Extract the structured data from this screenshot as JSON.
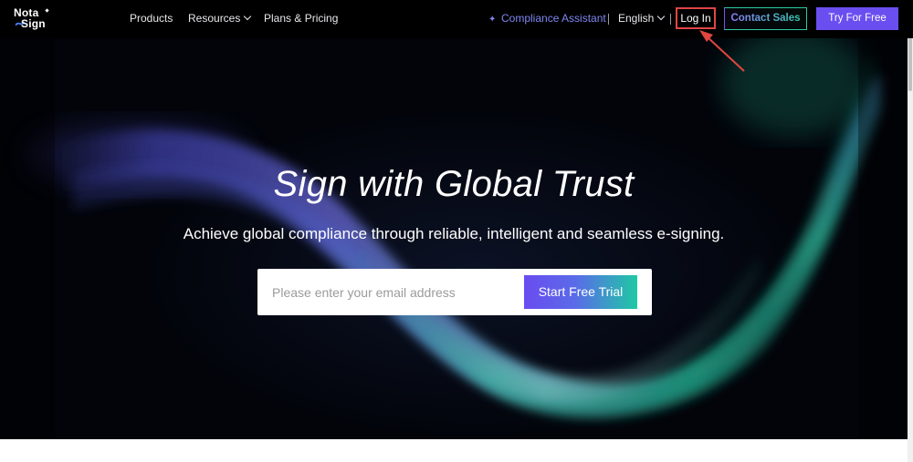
{
  "brand": {
    "logo_line1": "Nota",
    "logo_line2": "Sign"
  },
  "nav": {
    "products": "Products",
    "resources": "Resources",
    "plans_pricing": "Plans & Pricing",
    "compliance_assistant": "Compliance Assistant",
    "language": "English",
    "login": "Log In",
    "contact_sales": "Contact Sales",
    "try_free": "Try For Free"
  },
  "hero": {
    "title": "Sign with Global Trust",
    "subtitle": "Achieve global compliance through reliable, intelligent and seamless e-signing.",
    "email_placeholder": "Please enter your email address",
    "cta": "Start Free Trial"
  },
  "colors": {
    "accent_purple": "#6b4ef0",
    "accent_teal": "#1fc9a5",
    "assistant_link": "#7f86f0",
    "highlight_red": "#e04545"
  },
  "icons": {
    "assistant": "sparkle-icon",
    "dropdown": "chevron-down-icon",
    "annotation": "red-arrow-icon"
  }
}
